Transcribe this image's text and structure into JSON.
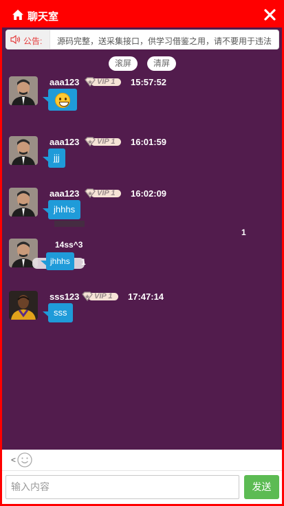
{
  "header": {
    "title": "聊天室"
  },
  "notice": {
    "label": "公告:",
    "text": "源码完整，送采集接口，供学习借鉴之用，请不要用于违法"
  },
  "controls": {
    "scroll_label": "滚屏",
    "clear_label": "清屏"
  },
  "messages": [
    {
      "user": "aaa123",
      "vip": "VIP 1",
      "time": "15:57:52",
      "text": "",
      "emoji": "grin-emoji-icon"
    },
    {
      "user": "aaa123",
      "vip": "VIP 1",
      "time": "16:01:59",
      "text": "jjj"
    },
    {
      "user": "aaa123",
      "vip": "VIP 1",
      "time": "16:02:09",
      "text": "jhhhs"
    },
    {
      "user": "",
      "vip": "",
      "time": "",
      "text": "jhhhs"
    },
    {
      "user": "sss123",
      "vip": "VIP 1",
      "time": "17:47:14",
      "text": "sss"
    }
  ],
  "glitch_fragments": [
    "1",
    "14ss^3",
    "1"
  ],
  "composer": {
    "back_glyph": "<",
    "placeholder": "输入内容",
    "send_label": "发送"
  },
  "colors": {
    "header": "#ff0000",
    "background": "#521c4d",
    "bubble": "#1f9bd9",
    "send": "#5cbb53"
  }
}
